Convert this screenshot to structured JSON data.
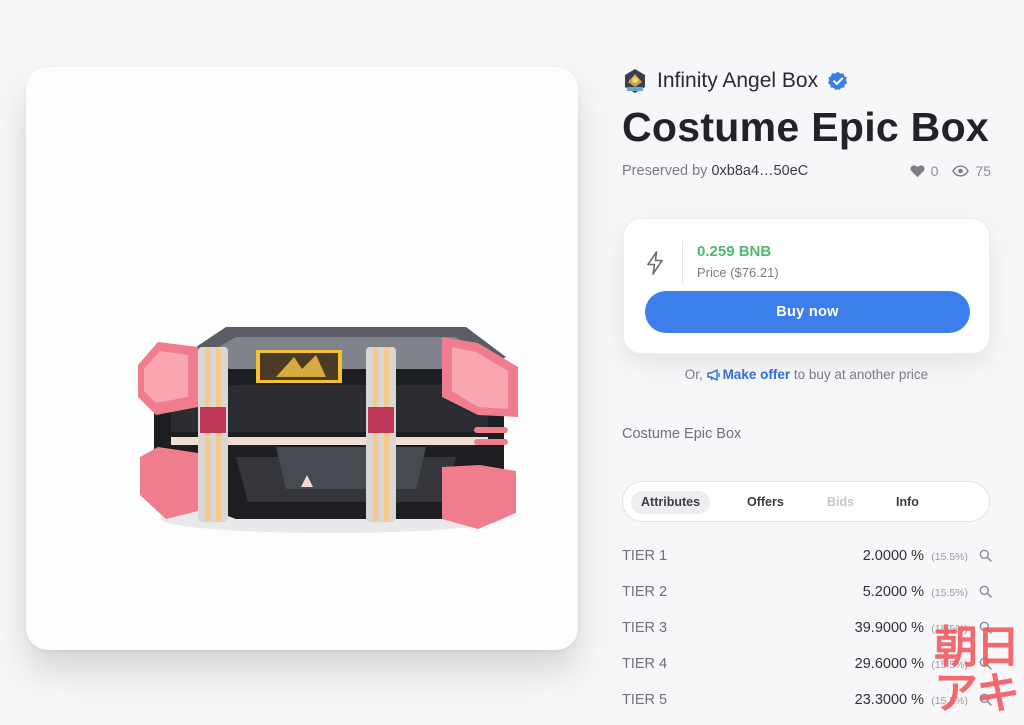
{
  "collection": {
    "name": "Infinity Angel Box",
    "logo_icon": "angel-box-logo",
    "verified_icon": "verified-badge-icon"
  },
  "item": {
    "title": "Costume Epic Box",
    "owner_prefix": "Preserved by",
    "owner_address": "0xb8a4…50eC",
    "likes": "0",
    "views": "75",
    "description": "Costume Epic Box"
  },
  "price": {
    "value": "0.259 BNB",
    "label": "Price ($76.21)",
    "value_color": "#4cb96e",
    "buy_label": "Buy now",
    "buy_color": "#3d7fea"
  },
  "offer": {
    "prefix": "Or,",
    "link_label": "Make offer",
    "suffix": "to buy at another price"
  },
  "tabs": [
    "Attributes",
    "Offers",
    "Bids",
    "Info"
  ],
  "attributes": [
    {
      "name": "TIER 1",
      "value": "2.0000 %",
      "share": "(15.5%)"
    },
    {
      "name": "TIER 2",
      "value": "5.2000 %",
      "share": "(15.5%)"
    },
    {
      "name": "TIER 3",
      "value": "39.9000 %",
      "share": "(15.5%)"
    },
    {
      "name": "TIER 4",
      "value": "29.6000 %",
      "share": "(15.5%)"
    },
    {
      "name": "TIER 5",
      "value": "23.3000 %",
      "share": "(15.5%)"
    }
  ],
  "watermark": {
    "line1": "朝日",
    "line2": "アキ"
  }
}
